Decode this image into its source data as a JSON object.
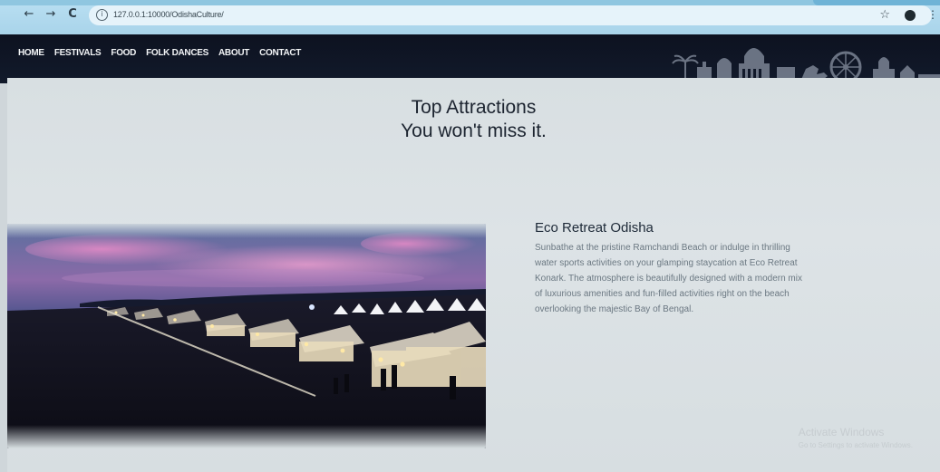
{
  "browser": {
    "back_glyph": "←",
    "forward_glyph": "→",
    "reload_glyph": "C",
    "info_glyph": "i",
    "url": "127.0.0.1:10000/OdishaCulture/",
    "star_glyph": "☆",
    "menu_glyph": "⋮"
  },
  "nav": {
    "items": [
      "HOME",
      "FESTIVALS",
      "FOOD",
      "FOLK DANCES",
      "ABOUT",
      "CONTACT"
    ]
  },
  "section": {
    "heading_line1": "Top Attractions",
    "heading_line2": "You won't miss it."
  },
  "attraction": {
    "title": "Eco Retreat Odisha",
    "description": "Sunbathe at the pristine Ramchandi Beach or indulge in thrilling water sports activities on your glamping staycation at Eco Retreat Konark. The atmosphere is beautifully designed with a modern mix of luxurious amenities and fun-filled activities right on the beach overlooking the majestic Bay of Bengal."
  },
  "watermark": {
    "line1": "Activate Windows",
    "line2": "Go to Settings to activate Windows."
  },
  "colors": {
    "chrome": "#b9dff2",
    "header": "#0d1220",
    "content_bg": "#d8dfe2"
  }
}
